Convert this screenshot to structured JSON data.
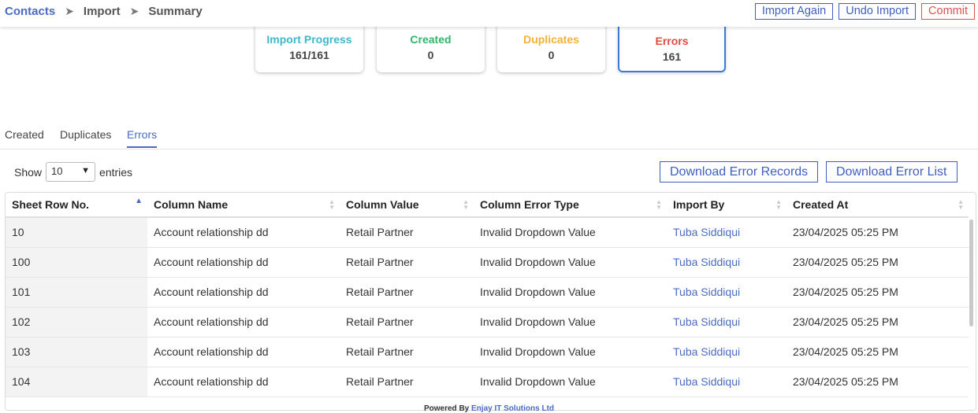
{
  "breadcrumb": {
    "root": "Contacts",
    "middle": "Import",
    "current": "Summary"
  },
  "actions": {
    "import_again": "Import Again",
    "undo_import": "Undo Import",
    "commit": "Commit"
  },
  "cards": [
    {
      "label": "Import Progress",
      "value": "161/161",
      "color": "#3fb8c9"
    },
    {
      "label": "Created",
      "value": "0",
      "color": "#2fb56b"
    },
    {
      "label": "Duplicates",
      "value": "0",
      "color": "#f0b23a"
    },
    {
      "label": "Errors",
      "value": "161",
      "color": "#e04b3f"
    }
  ],
  "tabs": {
    "created": "Created",
    "duplicates": "Duplicates",
    "errors": "Errors",
    "active": "Errors"
  },
  "entries": {
    "show": "Show",
    "value": "10",
    "suffix": "entries"
  },
  "buttons": {
    "download_records": "Download Error Records",
    "download_list": "Download Error List"
  },
  "table": {
    "columns": [
      "Sheet Row No.",
      "Column Name",
      "Column Value",
      "Column Error Type",
      "Import By",
      "Created At"
    ],
    "sorted_column": "Sheet Row No.",
    "rows": [
      [
        "10",
        "Account relationship dd",
        "Retail Partner",
        "Invalid Dropdown Value",
        "Tuba Siddiqui",
        "23/04/2025 05:25 PM"
      ],
      [
        "100",
        "Account relationship dd",
        "Retail Partner",
        "Invalid Dropdown Value",
        "Tuba Siddiqui",
        "23/04/2025 05:25 PM"
      ],
      [
        "101",
        "Account relationship dd",
        "Retail Partner",
        "Invalid Dropdown Value",
        "Tuba Siddiqui",
        "23/04/2025 05:25 PM"
      ],
      [
        "102",
        "Account relationship dd",
        "Retail Partner",
        "Invalid Dropdown Value",
        "Tuba Siddiqui",
        "23/04/2025 05:25 PM"
      ],
      [
        "103",
        "Account relationship dd",
        "Retail Partner",
        "Invalid Dropdown Value",
        "Tuba Siddiqui",
        "23/04/2025 05:25 PM"
      ],
      [
        "104",
        "Account relationship dd",
        "Retail Partner",
        "Invalid Dropdown Value",
        "Tuba Siddiqui",
        "23/04/2025 05:25 PM"
      ]
    ]
  },
  "footer": {
    "prefix": "Powered By",
    "brand": "Enjay IT Solutions Ltd"
  },
  "colors": {
    "accent": "#4a6bc4",
    "commit": "#d9534f"
  }
}
